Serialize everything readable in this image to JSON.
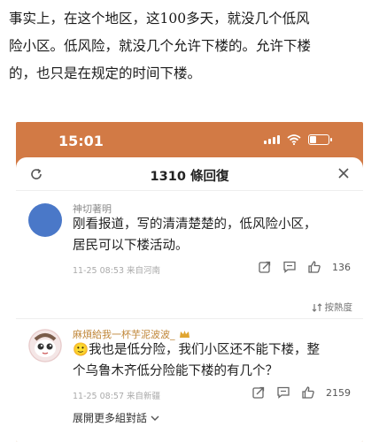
{
  "article": {
    "lines": [
      "事实上，在这个地区，这100多天，就没几个低风",
      "险小区。低风险，就没几个允许下楼的。允许下楼",
      "的，也只是在规定的时间下楼。"
    ]
  },
  "status_bar": {
    "time": "15:01",
    "battery_level": 0.35,
    "color": "#d27a45"
  },
  "sheet": {
    "title": "1310 條回復"
  },
  "comments": [
    {
      "name": "神切著明",
      "body_lines": [
        "刚看报道，写的清清楚楚的，低风险小区，",
        "居民可以下楼活动。"
      ],
      "meta": "11-25 08:53  来自河南",
      "likes": "136",
      "avatar_color": "#4a78c8"
    },
    {
      "name": "麻煩給我一杯芋泥波波_",
      "emoji": "🙂",
      "body_lines": [
        "我也是低分险，我们小区还不能下楼，整",
        "个乌鲁木齐低分险能下楼的有几个？"
      ],
      "meta": "11-25 08:57  来自新疆",
      "likes": "2159"
    }
  ],
  "sort": {
    "label": "按熱度"
  },
  "expand": {
    "label": "展開更多組對話"
  }
}
